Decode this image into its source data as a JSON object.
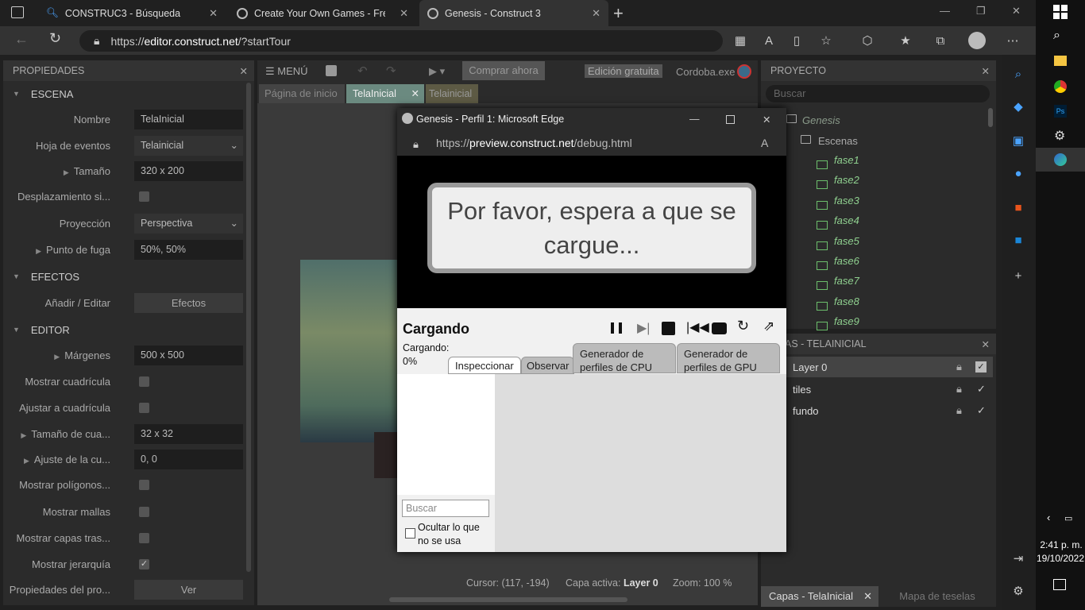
{
  "browser": {
    "tabs": [
      {
        "title": "CONSTRUC3 - Búsqueda"
      },
      {
        "title": "Create Your Own Games - Free T"
      },
      {
        "title": "Genesis - Construct 3"
      }
    ],
    "url_prefix": "https://",
    "url_host": "editor.construct.net",
    "url_path": "/?startTour"
  },
  "properties": {
    "title": "PROPIEDADES",
    "scene_section": "ESCENA",
    "rows": [
      {
        "label": "Nombre",
        "value": "TelaInicial"
      },
      {
        "label": "Hoja de eventos",
        "value": "Telainicial"
      },
      {
        "label": "Tamaño",
        "value": "320 x 200"
      },
      {
        "label": "Desplazamiento si...",
        "value": ""
      },
      {
        "label": "Proyección",
        "value": "Perspectiva"
      },
      {
        "label": "Punto de fuga",
        "value": "50%, 50%"
      }
    ],
    "effects_section": "EFECTOS",
    "effects_label": "Añadir / Editar",
    "effects_button": "Efectos",
    "editor_section": "EDITOR",
    "editor_rows": [
      {
        "label": "Márgenes",
        "value": "500 x 500"
      },
      {
        "label": "Mostrar cuadrícula",
        "value": ""
      },
      {
        "label": "Ajustar a cuadrícula",
        "value": ""
      },
      {
        "label": "Tamaño de cua...",
        "value": "32 x 32"
      },
      {
        "label": "Ajuste de la cu...",
        "value": "0, 0"
      },
      {
        "label": "Mostrar polígonos...",
        "value": ""
      },
      {
        "label": "Mostrar mallas",
        "value": ""
      },
      {
        "label": "Mostrar capas tras...",
        "value": ""
      },
      {
        "label": "Mostrar jerarquía",
        "value": ""
      }
    ],
    "project_props_label": "Propiedades del pro...",
    "project_props_button": "Ver"
  },
  "toolbar": {
    "menu": "MENÚ",
    "buy": "Comprar ahora",
    "edition": "Edición gratuita",
    "user": "Cordoba.exe"
  },
  "doc_tabs": [
    "Página de inicio",
    "TelaInicial",
    "Telainicial"
  ],
  "preview": {
    "title": "Genesis - Perfil 1: Microsoft Edge",
    "url_prefix": "https://",
    "url_host": "preview.construct.net",
    "url_path": "/debug.html",
    "message": "Por favor, espera a que se cargue...",
    "debug_title": "Cargando",
    "loading_label": "Cargando:",
    "loading_pct": "0%",
    "tabs": [
      "Inspeccionar",
      "Observar",
      "Generador de perfiles de CPU",
      "Generador de perfiles de GPU"
    ],
    "search_placeholder": "Buscar",
    "hide_unused": "Ocultar lo que no se usa"
  },
  "status": {
    "cursor": "Cursor: (117, -194)",
    "layer_label": "Capa activa:",
    "layer_value": "Layer 0",
    "zoom": "Zoom: 100 %"
  },
  "project": {
    "title": "PROYECTO",
    "search_placeholder": "Buscar",
    "root": "Genesis",
    "folder": "Escenas",
    "items": [
      "fase1",
      "fase2",
      "fase3",
      "fase4",
      "fase5",
      "fase6",
      "fase7",
      "fase8",
      "fase9"
    ]
  },
  "layers": {
    "title": "AS - TELAINICIAL",
    "items": [
      "Layer 0",
      "tiles",
      "fundo"
    ],
    "bottom_tabs": [
      "Capas - TelaInicial",
      "Mapa de teselas"
    ]
  },
  "clock": {
    "time": "2:41 p. m.",
    "date": "19/10/2022"
  }
}
